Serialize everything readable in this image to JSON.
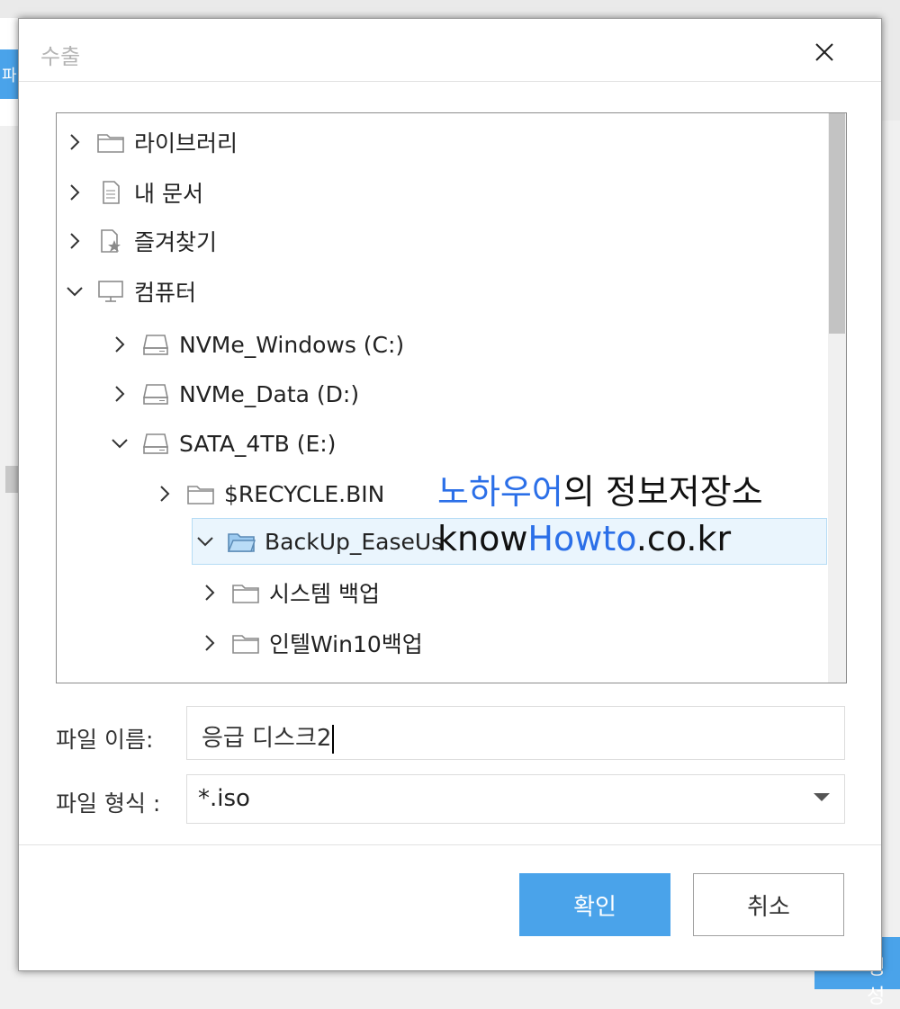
{
  "background": {
    "tab_fragment": "파",
    "button_fragment": "생성"
  },
  "dialog": {
    "title": "수출",
    "close_icon": "close-icon"
  },
  "tree": {
    "items": [
      {
        "label": "라이브러리",
        "expanded": false,
        "icon": "folder-icon"
      },
      {
        "label": "내 문서",
        "expanded": false,
        "icon": "document-icon"
      },
      {
        "label": "즐겨찾기",
        "expanded": false,
        "icon": "favorites-icon"
      },
      {
        "label": "컴퓨터",
        "expanded": true,
        "icon": "computer-icon"
      },
      {
        "label": "NVMe_Windows (C:)",
        "expanded": false,
        "icon": "drive-icon"
      },
      {
        "label": "NVMe_Data (D:)",
        "expanded": false,
        "icon": "drive-icon"
      },
      {
        "label": "SATA_4TB (E:)",
        "expanded": true,
        "icon": "drive-icon"
      },
      {
        "label": "$RECYCLE.BIN",
        "expanded": false,
        "icon": "folder-icon"
      },
      {
        "label": "BackUp_EaseUs",
        "expanded": true,
        "selected": true,
        "icon": "folder-icon"
      },
      {
        "label": "시스템 백업",
        "expanded": false,
        "icon": "folder-icon"
      },
      {
        "label": "인텔Win10백업",
        "expanded": false,
        "icon": "folder-icon"
      }
    ]
  },
  "watermark": {
    "line1_blue": "노하우어",
    "line1_rest": "의 정보저장소",
    "line2_pre": "know",
    "line2_blue": "Howto",
    "line2_post": ".co.kr"
  },
  "form": {
    "filename_label": "파일 이름:",
    "filename_value": "응급 디스크2",
    "filetype_label": "파일 형식 :",
    "filetype_value": "*.iso"
  },
  "buttons": {
    "ok": "확인",
    "cancel": "취소"
  },
  "colors": {
    "accent": "#4aa3ea",
    "selection": "#eaf5fd",
    "watermark_blue": "#2b6fe8"
  }
}
